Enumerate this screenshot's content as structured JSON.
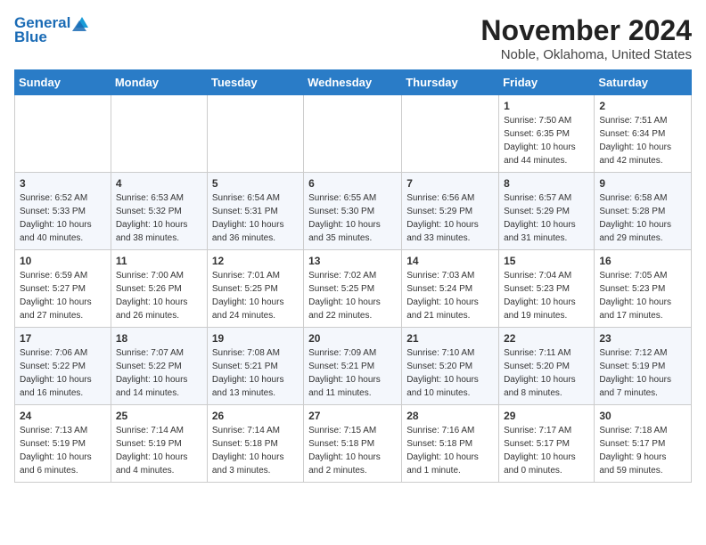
{
  "logo": {
    "general": "General",
    "blue": "Blue"
  },
  "header": {
    "title": "November 2024",
    "subtitle": "Noble, Oklahoma, United States"
  },
  "weekdays": [
    "Sunday",
    "Monday",
    "Tuesday",
    "Wednesday",
    "Thursday",
    "Friday",
    "Saturday"
  ],
  "weeks": [
    [
      {
        "day": "",
        "info": ""
      },
      {
        "day": "",
        "info": ""
      },
      {
        "day": "",
        "info": ""
      },
      {
        "day": "",
        "info": ""
      },
      {
        "day": "",
        "info": ""
      },
      {
        "day": "1",
        "info": "Sunrise: 7:50 AM\nSunset: 6:35 PM\nDaylight: 10 hours\nand 44 minutes."
      },
      {
        "day": "2",
        "info": "Sunrise: 7:51 AM\nSunset: 6:34 PM\nDaylight: 10 hours\nand 42 minutes."
      }
    ],
    [
      {
        "day": "3",
        "info": "Sunrise: 6:52 AM\nSunset: 5:33 PM\nDaylight: 10 hours\nand 40 minutes."
      },
      {
        "day": "4",
        "info": "Sunrise: 6:53 AM\nSunset: 5:32 PM\nDaylight: 10 hours\nand 38 minutes."
      },
      {
        "day": "5",
        "info": "Sunrise: 6:54 AM\nSunset: 5:31 PM\nDaylight: 10 hours\nand 36 minutes."
      },
      {
        "day": "6",
        "info": "Sunrise: 6:55 AM\nSunset: 5:30 PM\nDaylight: 10 hours\nand 35 minutes."
      },
      {
        "day": "7",
        "info": "Sunrise: 6:56 AM\nSunset: 5:29 PM\nDaylight: 10 hours\nand 33 minutes."
      },
      {
        "day": "8",
        "info": "Sunrise: 6:57 AM\nSunset: 5:29 PM\nDaylight: 10 hours\nand 31 minutes."
      },
      {
        "day": "9",
        "info": "Sunrise: 6:58 AM\nSunset: 5:28 PM\nDaylight: 10 hours\nand 29 minutes."
      }
    ],
    [
      {
        "day": "10",
        "info": "Sunrise: 6:59 AM\nSunset: 5:27 PM\nDaylight: 10 hours\nand 27 minutes."
      },
      {
        "day": "11",
        "info": "Sunrise: 7:00 AM\nSunset: 5:26 PM\nDaylight: 10 hours\nand 26 minutes."
      },
      {
        "day": "12",
        "info": "Sunrise: 7:01 AM\nSunset: 5:25 PM\nDaylight: 10 hours\nand 24 minutes."
      },
      {
        "day": "13",
        "info": "Sunrise: 7:02 AM\nSunset: 5:25 PM\nDaylight: 10 hours\nand 22 minutes."
      },
      {
        "day": "14",
        "info": "Sunrise: 7:03 AM\nSunset: 5:24 PM\nDaylight: 10 hours\nand 21 minutes."
      },
      {
        "day": "15",
        "info": "Sunrise: 7:04 AM\nSunset: 5:23 PM\nDaylight: 10 hours\nand 19 minutes."
      },
      {
        "day": "16",
        "info": "Sunrise: 7:05 AM\nSunset: 5:23 PM\nDaylight: 10 hours\nand 17 minutes."
      }
    ],
    [
      {
        "day": "17",
        "info": "Sunrise: 7:06 AM\nSunset: 5:22 PM\nDaylight: 10 hours\nand 16 minutes."
      },
      {
        "day": "18",
        "info": "Sunrise: 7:07 AM\nSunset: 5:22 PM\nDaylight: 10 hours\nand 14 minutes."
      },
      {
        "day": "19",
        "info": "Sunrise: 7:08 AM\nSunset: 5:21 PM\nDaylight: 10 hours\nand 13 minutes."
      },
      {
        "day": "20",
        "info": "Sunrise: 7:09 AM\nSunset: 5:21 PM\nDaylight: 10 hours\nand 11 minutes."
      },
      {
        "day": "21",
        "info": "Sunrise: 7:10 AM\nSunset: 5:20 PM\nDaylight: 10 hours\nand 10 minutes."
      },
      {
        "day": "22",
        "info": "Sunrise: 7:11 AM\nSunset: 5:20 PM\nDaylight: 10 hours\nand 8 minutes."
      },
      {
        "day": "23",
        "info": "Sunrise: 7:12 AM\nSunset: 5:19 PM\nDaylight: 10 hours\nand 7 minutes."
      }
    ],
    [
      {
        "day": "24",
        "info": "Sunrise: 7:13 AM\nSunset: 5:19 PM\nDaylight: 10 hours\nand 6 minutes."
      },
      {
        "day": "25",
        "info": "Sunrise: 7:14 AM\nSunset: 5:19 PM\nDaylight: 10 hours\nand 4 minutes."
      },
      {
        "day": "26",
        "info": "Sunrise: 7:14 AM\nSunset: 5:18 PM\nDaylight: 10 hours\nand 3 minutes."
      },
      {
        "day": "27",
        "info": "Sunrise: 7:15 AM\nSunset: 5:18 PM\nDaylight: 10 hours\nand 2 minutes."
      },
      {
        "day": "28",
        "info": "Sunrise: 7:16 AM\nSunset: 5:18 PM\nDaylight: 10 hours\nand 1 minute."
      },
      {
        "day": "29",
        "info": "Sunrise: 7:17 AM\nSunset: 5:17 PM\nDaylight: 10 hours\nand 0 minutes."
      },
      {
        "day": "30",
        "info": "Sunrise: 7:18 AM\nSunset: 5:17 PM\nDaylight: 9 hours\nand 59 minutes."
      }
    ]
  ]
}
